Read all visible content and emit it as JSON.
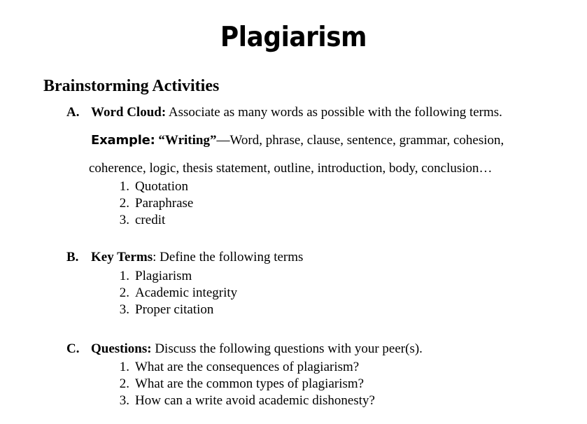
{
  "document": {
    "title": "Plagiarism",
    "section_heading": "Brainstorming Activities",
    "sections": [
      {
        "marker": "A.",
        "lead": "Word Cloud:",
        "text": " Associate as many words as possible with the following terms.",
        "example": {
          "label": "Example:",
          "quoted_term": "“Writing”",
          "dash_text": "—Word, phrase, clause, sentence, grammar, cohesion,",
          "continuation": "coherence, logic, thesis statement, outline, introduction, body, conclusion…"
        },
        "items": [
          {
            "num": "1.",
            "text": "Quotation"
          },
          {
            "num": "2.",
            "text": "Paraphrase"
          },
          {
            "num": "3.",
            "text": "credit"
          }
        ]
      },
      {
        "marker": "B.",
        "lead": "Key Terms",
        "text": ": Define the following terms",
        "items": [
          {
            "num": "1.",
            "text": "Plagiarism"
          },
          {
            "num": "2.",
            "text": "Academic integrity"
          },
          {
            "num": "3.",
            "text": "Proper citation"
          }
        ]
      },
      {
        "marker": "C.",
        "lead": "Questions:",
        "text": " Discuss the following questions with your peer(s).",
        "items": [
          {
            "num": "1.",
            "text": "What are the consequences of plagiarism?"
          },
          {
            "num": "2.",
            "text": "What are the common types of plagiarism?"
          },
          {
            "num": "3.",
            "text": "How can a write avoid academic dishonesty?"
          }
        ]
      }
    ]
  }
}
